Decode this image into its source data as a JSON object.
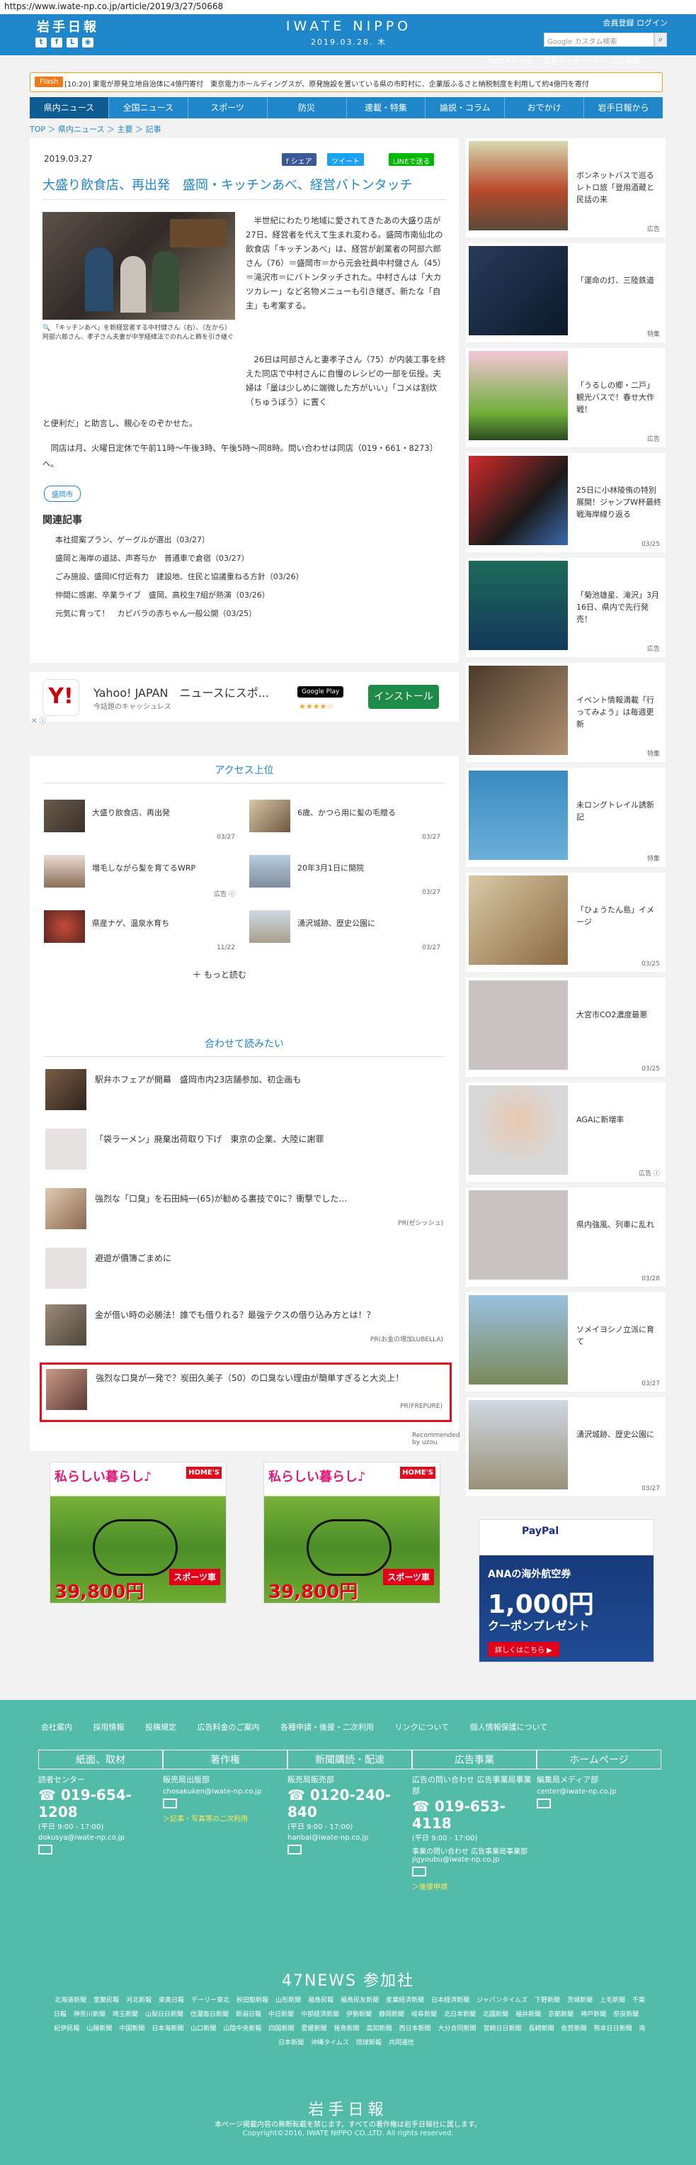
{
  "url": "https://www.iwate-np.co.jp/article/2019/3/27/50668",
  "header": {
    "top_logo": "岩手日報",
    "social_icons": [
      "twitter-icon",
      "facebook-icon",
      "line-icon",
      "rss-icon"
    ],
    "site_logo": "IWATE NIPPO",
    "date": "2019.03.28. 木",
    "member_register": "会員登録",
    "login": "ログイン",
    "search_placeholder": "Google カスタム検索",
    "sub_links": "Webアルバム ｜ 記事データベース ｜ 広告掲載 ｜"
  },
  "ticker": {
    "badge": "Flash",
    "text": "[10:20] 東電が原発立地自治体に4億円寄付　東京電力ホールディングスが、原発施設を置いている県の市町村に、企業版ふるさと納税制度を利用して約4億円を寄付"
  },
  "nav": [
    "県内ニュース",
    "全国ニュース",
    "スポーツ",
    "防災",
    "連載・特集",
    "論説・コラム",
    "おでかけ",
    "岩手日報から"
  ],
  "breadcrumb": "TOP ＞ 県内ニュース ＞ 主要 ＞ 記事",
  "article": {
    "date": "2019.03.27",
    "share": "f シェア",
    "tweet": "ツイート",
    "line": "LINEで送る",
    "title": "大盛り飲食店、再出発　盛岡・キッチンあべ、経営バトンタッチ",
    "caption": "「キッチンあべ」を新経営者する中村健さん（右）、（左から）阿部六郎さん、孝子さん夫妻が中学経緯法でのれんと飾を引き継ぐ",
    "body1": "半世紀にわたり地域に愛されてきたあの大盛り店が27日、経営者を代えて生まれ変わる。盛岡市南仙北の飲食店「キッチンあべ」は、経営が創業者の阿部六郎さん（76）＝盛岡市＝から元会社員中村健さん（45）＝滝沢市＝にバトンタッチされた。中村さんは「大カツカレー」など名物メニューも引き継ぎ、新たな「自主」も考案する。",
    "body2": "26日は阿部さんと妻孝子さん（75）が内装工事を終えた同店で中村さんに自慢のレシピの一部を伝授。夫婦は「量は少しめに端微した方がいい」「コメは割炊（ちゅうぼう）に置く",
    "body3": "と便利だ」と助言し、親心をのぞかせた。",
    "body4": "同店は月、火曜日定休で午前11時～午後3時、午後5時～同8時。問い合わせは同店（019・661・8273）へ。",
    "tag": "盛岡市",
    "related_heading": "関連記事",
    "related": [
      "本社提案プラン、ゲーグルが選出（03/27）",
      "盛岡と海岸の道誌、声寄与か　普通車で倉宿（03/27）",
      "ごみ施設、盛岡IC付近有力　建設地、住民と協議重ねる方針（03/26）",
      "仲間に感謝、卒業ライブ　盛岡、高校生7組が熱演（03/26）",
      "元気に育って！　カピバラの赤ちゃん一般公開（03/25）"
    ]
  },
  "app_ad": {
    "logo": "Y!",
    "title": "Yahoo! JAPAN　ニュースにスポ...",
    "sub": "今話題のキャッシュレス",
    "store": "Google Play",
    "stars": "★★★★☆",
    "install": "インストール",
    "close": "✕ ⓘ"
  },
  "ranking": {
    "heading": "アクセス上位",
    "items": [
      {
        "title": "大盛り飲食店、再出発",
        "date": "03/27"
      },
      {
        "title": "6歳、かつら用に髪の毛贈る",
        "date": "03/27"
      },
      {
        "title": "増毛しながら髪を育てるWRP",
        "date": "広告 ⓘ"
      },
      {
        "title": "20年3月1日に開院",
        "date": "03/27"
      },
      {
        "title": "県産ナゲ、温泉水育ち",
        "date": "11/22"
      },
      {
        "title": "湧沢城跡、歴史公園に",
        "date": "03/27"
      }
    ],
    "more": "＋ もっと読む"
  },
  "recommend": {
    "heading": "合わせて読みたい",
    "items": [
      {
        "title": "駅弁ホフェアが開幕　盛岡市内23店舗参加、初企画も",
        "pr": ""
      },
      {
        "title": "「袋ラーメン」廃棄出荷取り下げ　東京の企業、大陸に謝罪",
        "pr": ""
      },
      {
        "title": "強烈な「口臭」を石田純一(65)が勧める裏技で0に？衝撃でした…",
        "pr": "PR(ゼシッシュ)"
      },
      {
        "title": "避遊が價簿ごまめに",
        "pr": ""
      },
      {
        "title": "金が借い時の必勝法！誰でも借りれる？最強テクスの借り込み方とは！？",
        "pr": "PR(お金の増加LUBELLA)"
      },
      {
        "title": "強烈な口臭が一発で？炭田久美子（50）の口臭ない理由が簡単すぎると大炎上！",
        "pr": "PR(FREPURE)"
      }
    ],
    "brand": "Recommended by uzou"
  },
  "banner_ads": [
    {
      "headline": "私らしい暮らし♪",
      "store": "HOME'S",
      "price": "39,800円",
      "category": "スポーツ車"
    },
    {
      "headline": "私らしい暮らし♪",
      "store": "HOME'S",
      "price": "39,800円",
      "category": "スポーツ車"
    }
  ],
  "sidebar": [
    {
      "title": "ボンネットバスで巡るレトロ旅「登用酒蔵と民話の来",
      "label": "広告"
    },
    {
      "title": "「運命の灯、三陸鉄道",
      "label": "特集"
    },
    {
      "title": "「うるしの郷・二戸」観光バスで！春せ大作戦！",
      "label": "広告"
    },
    {
      "title": "25日に小林陵侑の特別展開！ジャンプW杯最終戦海岸線り返る",
      "label": "03/25"
    },
    {
      "title": "「菊池雄星、滝沢」3月16日、県内で先行発売！",
      "label": "広告"
    },
    {
      "title": "イベント情報満載「行ってみよう」は毎週更新",
      "label": "特集"
    },
    {
      "title": "未ロングトレイル誘新記",
      "label": "特集"
    },
    {
      "title": "「ひょうたん島」イメージ",
      "label": "03/25"
    },
    {
      "title": "大宮市CO2濃度最悪",
      "label": "03/25"
    },
    {
      "title": "AGAに新増率",
      "label": "広告 ⓘ"
    },
    {
      "title": "県内強風、列車に乱れ",
      "label": "03/28"
    },
    {
      "title": "ソメイヨシノ立派に育て",
      "label": "03/27"
    },
    {
      "title": "湧沢城跡、歴史公園に",
      "label": "03/27"
    }
  ],
  "ana_ad": {
    "brand": "PayPal",
    "line1": "ANAの海外航空券",
    "line2": "1,000円",
    "line3": "クーポンプレゼント",
    "cta": "詳しくはこちら ▶"
  },
  "footer": {
    "links": [
      "会社案内",
      "採用情報",
      "投稿規定",
      "広告料金のご案内",
      "各種申請・後援・二次利用",
      "リンクについて",
      "個人情報保護について"
    ],
    "cols": [
      {
        "head": "紙面、取材",
        "label": "読者センター",
        "phone": "019-654-1208",
        "hours": "(平日 9:00 - 17:00)",
        "email": "dokusya@iwate-np.co.jp",
        "link": ""
      },
      {
        "head": "著作権",
        "label": "販売局出版部",
        "phone": "",
        "hours": "",
        "email": "chosakuken@iwate-np.co.jp",
        "link": "＞記事・写真等の二次利用"
      },
      {
        "head": "新聞購読・配達",
        "label": "販売局販売部",
        "phone": "0120-240-840",
        "hours": "(平日 9:00 - 17:00)",
        "email": "hanbai@iwate-np.co.jp",
        "link": ""
      },
      {
        "head": "広告事業",
        "label": "広告の問い合わせ 広告事業局事業部",
        "phone": "019-653-4118",
        "hours": "(平日 9:00 - 17:00)",
        "email": "事業の問い合わせ 広告事業局事業部 jigyoubu@iwate-np.co.jp",
        "link": "＞後援申請"
      },
      {
        "head": "ホームページ",
        "label": "編集局メディア部",
        "phone": "",
        "hours": "",
        "email": "center@iwate-np.co.jp",
        "link": ""
      }
    ],
    "n47_title": "47NEWS 参加社",
    "n47_members": [
      "北海道新聞",
      "室蘭民報",
      "河北新報",
      "東奥日報",
      "デーリー東北",
      "秋田魁新報",
      "山形新聞",
      "福島民報",
      "福島民友新聞",
      "産業経済新聞",
      "日本経済新聞",
      "ジャパンタイムズ",
      "下野新聞",
      "茨城新聞",
      "上毛新聞",
      "千葉日報",
      "神奈川新聞",
      "埼玉新聞",
      "山梨日日新聞",
      "信濃毎日新聞",
      "新潟日報",
      "中日新聞",
      "中部経済新聞",
      "伊勢新聞",
      "静岡新聞",
      "岐阜新聞",
      "北日本新聞",
      "北國新聞",
      "福井新聞",
      "京都新聞",
      "神戸新聞",
      "奈良新聞",
      "紀伊民報",
      "山陽新聞",
      "中国新聞",
      "日本海新聞",
      "山口新聞",
      "山陰中央新報",
      "四国新聞",
      "愛媛新聞",
      "徳島新聞",
      "高知新聞",
      "西日本新聞",
      "大分合同新聞",
      "宮崎日日新聞",
      "長崎新聞",
      "佐賀新聞",
      "熊本日日新聞",
      "南日本新聞",
      "沖縄タイムス",
      "琉球新報",
      "共同通信"
    ],
    "brand": "岩手日報",
    "note": "本ページ掲載内容の無断転載を禁じます。すべての著作権は岩手日報社に属します。",
    "copyright": "Copyright©2016, IWATE NIPPO CO.,LTD. All rights reserved."
  }
}
